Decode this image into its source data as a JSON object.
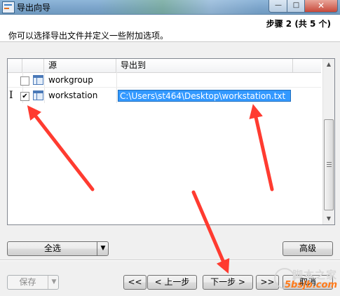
{
  "window": {
    "title": "导出向导",
    "minimize_symbol": "—",
    "maximize_symbol": "□",
    "close_symbol": "✕"
  },
  "header": {
    "step": "步骤 2 (共 5 个)",
    "description": "你可以选择导出文件并定义一些附加选项。"
  },
  "table": {
    "columns": [
      "源",
      "导出到"
    ],
    "rows": [
      {
        "checked": false,
        "source": "workgroup",
        "destination": "",
        "icon": "table-icon"
      },
      {
        "checked": true,
        "check_mark": "✔",
        "source": "workstation",
        "destination": "C:\\Users\\st464\\Desktop\\workstation.txt",
        "icon": "table-icon",
        "cursor": "I"
      }
    ]
  },
  "scrollbar": {
    "up": "▲",
    "down": "▼"
  },
  "buttons": {
    "select_all": "全选",
    "advanced": "高级",
    "save": "保存",
    "first": "<<",
    "prev": "< 上一步",
    "next": "下一步 >",
    "last": ">>",
    "cancel": "取消",
    "dropdown_arrow": "▼"
  },
  "watermark": {
    "top": "脚本之家",
    "bottom": "5bsjb.com"
  },
  "colors": {
    "annotation_arrow": "#ff3b30",
    "selection": "#3399ff"
  }
}
